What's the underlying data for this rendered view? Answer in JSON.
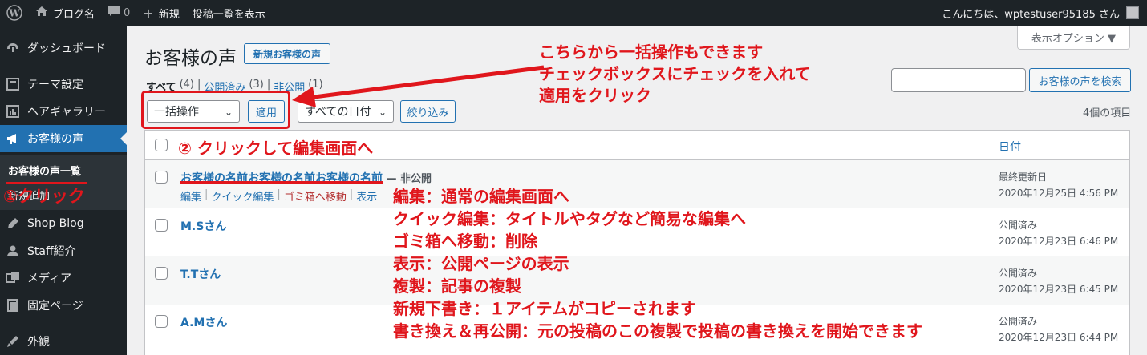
{
  "adminbar": {
    "site_name": "ブログ名",
    "comments_count": "0",
    "new_label": "新規",
    "view_posts": "投稿一覧を表示",
    "greeting": "こんにちは、wptestuser95185 さん"
  },
  "sidebar": {
    "items": [
      {
        "label": "ダッシュボード",
        "icon": "dashboard-icon"
      },
      {
        "label": "テーマ設定",
        "icon": "theme-settings-icon"
      },
      {
        "label": "ヘアギャラリー",
        "icon": "gallery-icon"
      },
      {
        "label": "お客様の声",
        "icon": "megaphone-icon"
      },
      {
        "label": "Shop Blog",
        "icon": "pin-icon"
      },
      {
        "label": "Staff紹介",
        "icon": "user-icon"
      },
      {
        "label": "メディア",
        "icon": "media-icon"
      },
      {
        "label": "固定ページ",
        "icon": "page-icon"
      },
      {
        "label": "外観",
        "icon": "appearance-icon"
      }
    ],
    "submenu": {
      "current": "お客様の声一覧",
      "second": "新規追加"
    }
  },
  "main": {
    "screen_options": "表示オプション ▼",
    "title": "お客様の声",
    "add_new": "新規お客様の声",
    "filters": {
      "all": "すべて",
      "all_count": "(4)",
      "published": "公開済み",
      "published_count": "(3)",
      "private": "非公開",
      "private_count": "(1)"
    },
    "search_button": "お客様の声を検索",
    "bulk_action": "一括操作",
    "apply": "適用",
    "date_filter": "すべての日付",
    "filter_button": "絞り込み",
    "items_count": "4個の項目",
    "col_date": "日付",
    "rows": [
      {
        "title": "お客様の名前お客様の名前お客様の名前",
        "state": " — 非公開",
        "status": "最終更新日",
        "date": "2020年12月25日 4:56 PM",
        "actions": {
          "edit": "編集",
          "quick_edit": "クイック編集",
          "trash": "ゴミ箱へ移動",
          "view": "表示"
        }
      },
      {
        "title": "M.Sさん",
        "state": "",
        "status": "公開済み",
        "date": "2020年12月23日 6:46 PM"
      },
      {
        "title": "T.Tさん",
        "state": "",
        "status": "公開済み",
        "date": "2020年12月23日 6:45 PM"
      },
      {
        "title": "A.Mさん",
        "state": "",
        "status": "公開済み",
        "date": "2020年12月23日 6:44 PM"
      }
    ]
  },
  "annotations": {
    "bulk_note_1": "こちらから一括操作もできます",
    "bulk_note_2": "チェックボックスにチェックを入れて",
    "bulk_note_3": "適用をクリック",
    "step1": "①クリック",
    "step2": "② クリックして編集画面へ",
    "lines": [
      "編集：通常の編集画面へ",
      "クイック編集：タイトルやタグなど簡易な編集へ",
      "ゴミ箱へ移動：削除",
      "表示：公開ページの表示",
      "複製：記事の複製",
      "新規下書き：１アイテムがコピーされます",
      "書き換え＆再公開：元の投稿のこの複製で投稿の書き換えを開始できます"
    ]
  },
  "colors": {
    "accent": "#2271b1",
    "annotation": "#e0161c",
    "dark": "#1d2327"
  }
}
